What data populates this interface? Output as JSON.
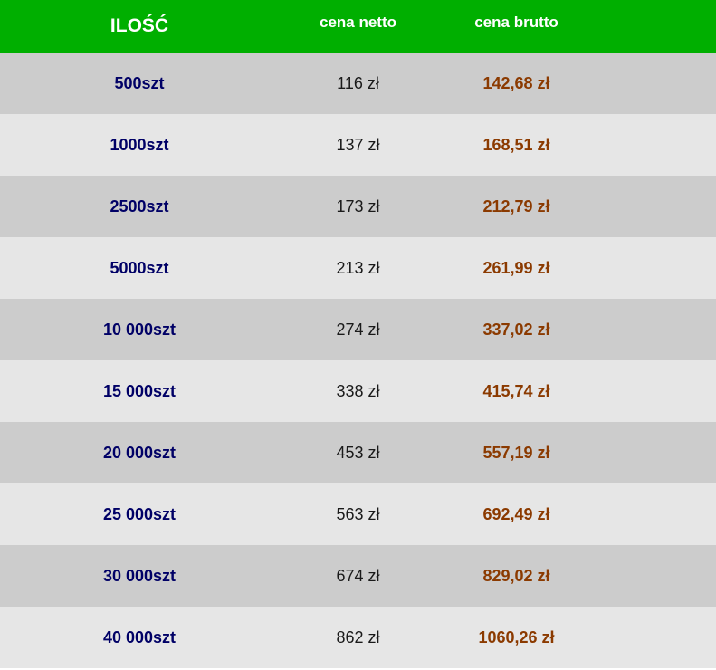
{
  "table": {
    "headers": {
      "quantity": "ILOŚĆ",
      "net_price": "cena netto",
      "gross_price": "cena brutto"
    },
    "rows": [
      {
        "quantity": "500szt",
        "net": "116 zł",
        "gross": "142,68 zł"
      },
      {
        "quantity": "1000szt",
        "net": "137 zł",
        "gross": "168,51 zł"
      },
      {
        "quantity": "2500szt",
        "net": "173 zł",
        "gross": "212,79 zł"
      },
      {
        "quantity": "5000szt",
        "net": "213 zł",
        "gross": "261,99 zł"
      },
      {
        "quantity": "10 000szt",
        "net": "274 zł",
        "gross": "337,02 zł"
      },
      {
        "quantity": "15 000szt",
        "net": "338 zł",
        "gross": "415,74 zł"
      },
      {
        "quantity": "20 000szt",
        "net": "453 zł",
        "gross": "557,19 zł"
      },
      {
        "quantity": "25 000szt",
        "net": "563 zł",
        "gross": "692,49 zł"
      },
      {
        "quantity": "30 000szt",
        "net": "674 zł",
        "gross": "829,02 zł"
      },
      {
        "quantity": "40 000szt",
        "net": "862 zł",
        "gross": "1060,26 zł"
      }
    ]
  },
  "colors": {
    "header_bg": "#00af00",
    "row_dark": "#cccccc",
    "row_light": "#e6e6e6",
    "quantity_text": "#000066",
    "gross_text": "#8b3a00"
  }
}
